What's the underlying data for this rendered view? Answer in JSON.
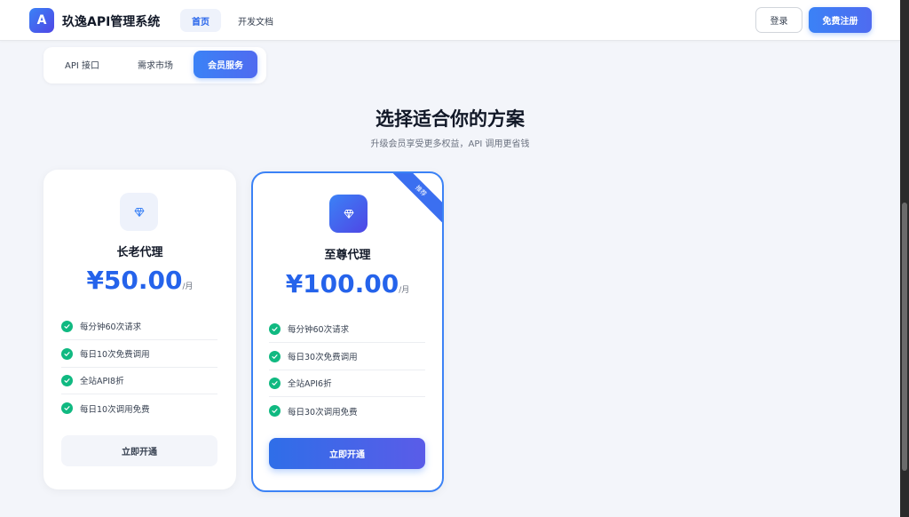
{
  "header": {
    "logo_letter": "A",
    "app_name": "玖逸API管理系统",
    "nav": [
      {
        "label": "首页",
        "active": true
      },
      {
        "label": "开发文档",
        "active": false
      }
    ],
    "login_label": "登录",
    "register_label": "免费注册"
  },
  "subtabs": [
    {
      "label": "API 接口",
      "active": false
    },
    {
      "label": "需求市场",
      "active": false
    },
    {
      "label": "会员服务",
      "active": true
    }
  ],
  "section": {
    "title": "选择适合你的方案",
    "subtitle": "升级会员享受更多权益，API 调用更省钱"
  },
  "plans": [
    {
      "name": "长老代理",
      "price": "¥50.00",
      "unit": "/月",
      "icon": "diamond-icon",
      "features": [
        "每分钟60次请求",
        "每日10次免费调用",
        "全站API8折",
        "每日10次调用免费"
      ],
      "button": "立即开通",
      "featured": false
    },
    {
      "name": "至尊代理",
      "price": "¥100.00",
      "unit": "/月",
      "icon": "diamond-icon",
      "ribbon": "推荐",
      "features": [
        "每分钟60次请求",
        "每日30次免费调用",
        "全站API6折",
        "每日30次调用免费"
      ],
      "button": "立即开通",
      "featured": true
    }
  ],
  "colors": {
    "accent": "#3b82f6",
    "check": "#10b981",
    "background": "#f3f5fa"
  }
}
